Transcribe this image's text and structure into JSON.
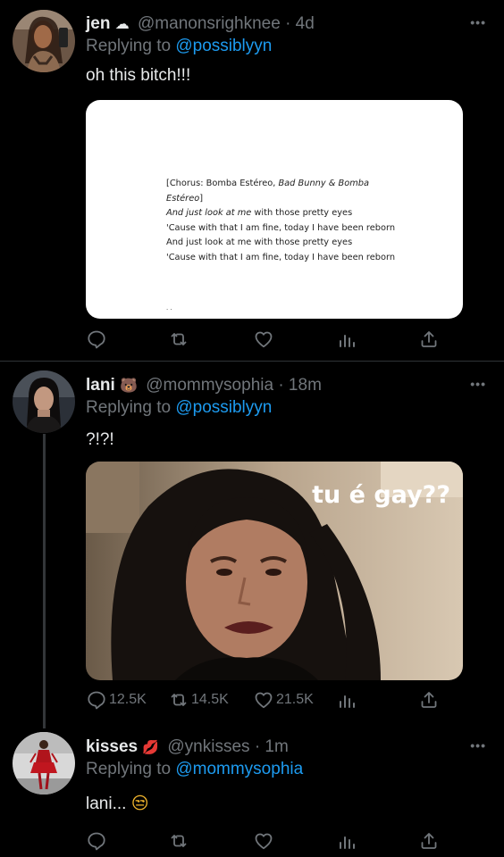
{
  "tweets": [
    {
      "name": "jen",
      "emoji": "☁",
      "handle": "@manonsrighknee",
      "time": "· 4d",
      "replying_prefix": "Replying to ",
      "replying_to": "@possiblyyn",
      "text": "oh this bitch!!!",
      "lyrics": {
        "line1": "[Chorus: Bomba Estéreo, ",
        "line1_italic": "Bad Bunny & Bomba",
        "line2_italic": "Estéreo",
        "line2_end": "]",
        "line3_italic": "And just look at me",
        "line3_rest": " with those pretty eyes",
        "line4": "'Cause with that I am fine, today I have been reborn",
        "line5": "And just look at me with those pretty eyes",
        "line6": "'Cause with that I am fine, today I have been reborn",
        "line7": ". ."
      }
    },
    {
      "name": "lani",
      "emoji": "🐻",
      "handle": "@mommysophia",
      "time": "· 18m",
      "replying_prefix": "Replying to ",
      "replying_to": "@possiblyyn",
      "text": "?!?!",
      "meme_caption": "tu é gay??",
      "replies": "12.5K",
      "retweets": "14.5K",
      "likes": "21.5K"
    },
    {
      "name": "kisses",
      "emoji": "💋",
      "handle": "@ynkisses",
      "time": "· 1m",
      "replying_prefix": "Replying to ",
      "replying_to": "@mommysophia",
      "text": "lani... ",
      "text_emoji": "😒"
    }
  ],
  "more_glyph": "•••",
  "colors": {
    "accent": "#1d9bf0",
    "muted": "#71767b",
    "bg": "#000000"
  }
}
